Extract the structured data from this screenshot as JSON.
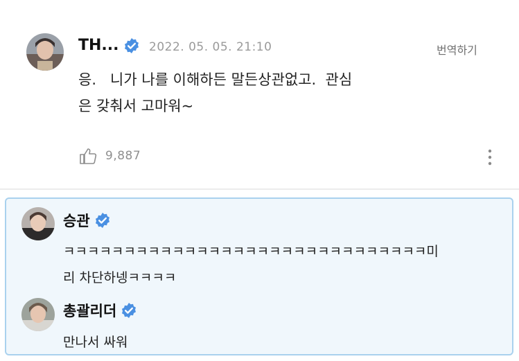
{
  "post": {
    "author": "TH...",
    "timestamp": "2022. 05. 05. 21:10",
    "translate_label": "번역하기",
    "text_line1": "응.   니가 나를 이해하든 말든상관없고.  관심",
    "text_line2": "은 갖춰서 고마워~",
    "like_count": "9,887",
    "like_icon": "thumbs-up-icon",
    "more_icon": "more-vertical-icon"
  },
  "replies": [
    {
      "author": "승관",
      "text_line1": "ㅋㅋㅋㅋㅋㅋㅋㅋㅋㅋㅋㅋㅋㅋㅋㅋㅋㅋㅋㅋㅋㅋㅋㅋㅋㅋㅋㅋㅋㅋ미",
      "text_line2": "리 차단하넹ㅋㅋㅋㅋ"
    },
    {
      "author": "총괄리더",
      "text_line1": "만나서 싸워"
    }
  ],
  "colors": {
    "verified": "#4a90e2",
    "reply_border": "#a9d1ee",
    "reply_background": "#f0f7fc"
  }
}
